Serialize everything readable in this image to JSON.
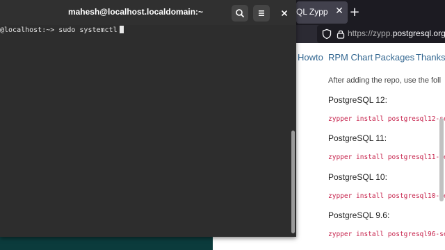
{
  "terminal": {
    "title": "mahesh@localhost.localdomain:~",
    "prompt": "@localhost:~> ",
    "command": "sudo systemctl"
  },
  "browser": {
    "tab_title": "QL Zypper",
    "url_prefix": "https://zypp.",
    "url_domain": "postgresql.org",
    "url_suffix": "/",
    "menu": [
      "Howto",
      "RPM Chart",
      "Packages",
      "Thanks"
    ],
    "content": {
      "intro": "After adding the repo, use the foll",
      "sections": [
        {
          "heading": "PostgreSQL 12:",
          "code": "zypper install postgresql12-se"
        },
        {
          "heading": "PostgreSQL 11:",
          "code": "zypper install postgresql11-se"
        },
        {
          "heading": "PostgreSQL 10:",
          "code": "zypper install postgresql10-se"
        },
        {
          "heading": "PostgreSQL 9.6:",
          "code": "zypper install postgresql96-se"
        }
      ]
    }
  },
  "colors": {
    "desktop": "#0b3b3c",
    "terminal_bg": "#2d2d2d",
    "link": "#336791",
    "code": "#c7254e"
  }
}
